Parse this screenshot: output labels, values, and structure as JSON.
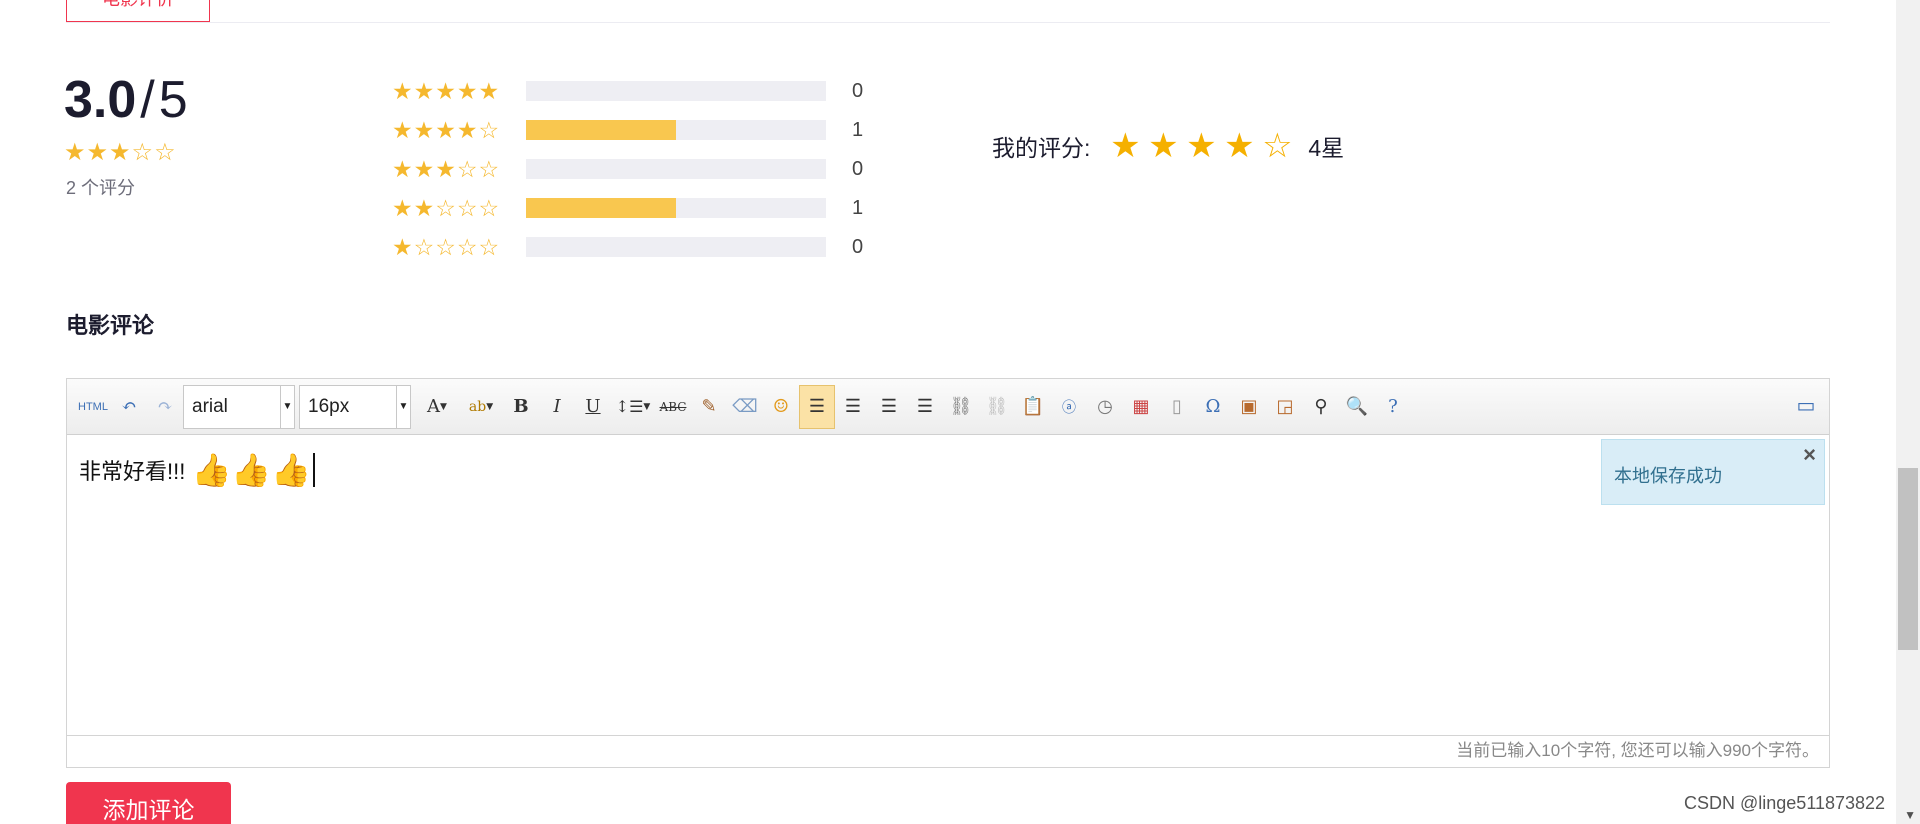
{
  "top_tab": {
    "label": "电影评价"
  },
  "summary": {
    "score": "3.0",
    "separator": "/",
    "max": "5",
    "stars": "★★★☆☆",
    "count_text": "2 个评分"
  },
  "distribution": [
    {
      "stars": "★★★★★",
      "count": "0",
      "fraction": 0
    },
    {
      "stars": "★★★★☆",
      "count": "1",
      "fraction": 0.5
    },
    {
      "stars": "★★★☆☆",
      "count": "0",
      "fraction": 0
    },
    {
      "stars": "★★☆☆☆",
      "count": "1",
      "fraction": 0.5
    },
    {
      "stars": "★☆☆☆☆",
      "count": "0",
      "fraction": 0
    }
  ],
  "my_rating": {
    "label": "我的评分:",
    "value": 4,
    "text": "4星"
  },
  "section_title": "电影评论",
  "toolbar": {
    "html_label": "HTML",
    "font_family": "arial",
    "font_size": "16px",
    "items": [
      "undo-icon",
      "redo-icon",
      "font-color-icon",
      "highlight-icon",
      "bold-icon",
      "italic-icon",
      "underline-icon",
      "line-height-icon",
      "strikethrough-icon",
      "format-brush-icon",
      "eraser-icon",
      "emoji-icon",
      "align-left-icon",
      "align-right-icon",
      "align-center-icon",
      "align-justify-icon",
      "link-icon",
      "unlink-icon",
      "paste-text-icon",
      "anchor-icon",
      "time-icon",
      "date-icon",
      "page-icon",
      "special-char-icon",
      "image-icon",
      "multi-image-icon",
      "find-replace-icon",
      "preview-icon",
      "help-icon",
      "fullscreen-icon"
    ]
  },
  "editor": {
    "content": "非常好看!!!",
    "thumbs": "👍👍👍",
    "toast": "本地保存成功",
    "word_count": "当前已输入10个字符, 您还可以输入990个字符。"
  },
  "add_button": "添加评论",
  "watermark": "CSDN @linge511873822",
  "colors": {
    "accent": "#f0354e",
    "star": "#f5b82e",
    "bar_fill": "#f9c74f"
  }
}
